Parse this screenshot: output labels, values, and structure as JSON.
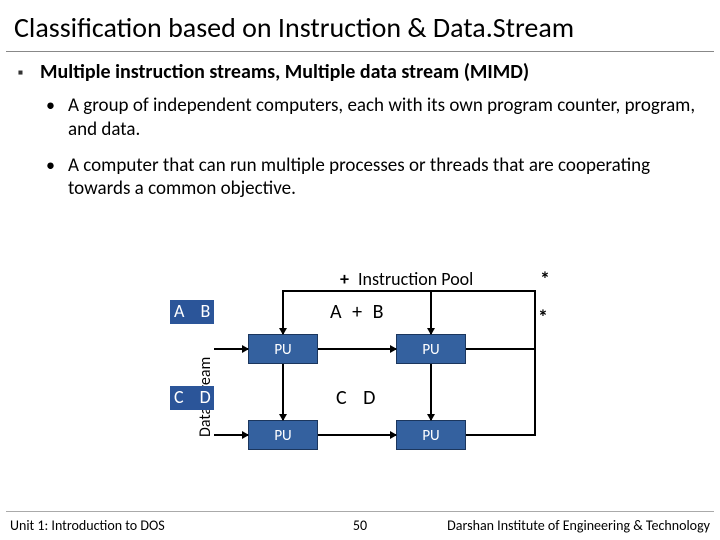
{
  "title": "Classification based on Instruction & Data.Stream",
  "heading": "Multiple instruction streams, Multiple data stream (MIMD)",
  "bullets": [
    "A group of independent computers, each with its own program counter, program, and data.",
    "A computer that can run multiple processes or threads that are cooperating towards a common objective."
  ],
  "diagram": {
    "instruction_pool": "Instruction Pool",
    "plus": "+",
    "star": "*",
    "data_stream": "Data Stream",
    "in1": "A B",
    "in2": "C D",
    "mid1": "A + B",
    "mid2": "C   D",
    "pu": "PU"
  },
  "footer": {
    "left": "Unit 1: Introduction to DOS",
    "mid": "50",
    "right": "Darshan Institute of Engineering & Technology"
  }
}
